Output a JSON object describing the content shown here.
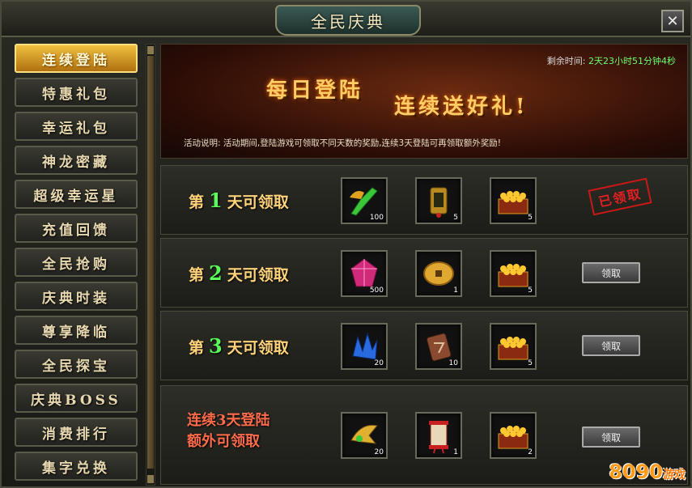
{
  "window": {
    "title": "全民庆典",
    "close": "✕"
  },
  "sidebar": {
    "items": [
      {
        "label": "连续登陆",
        "active": true
      },
      {
        "label": "特惠礼包"
      },
      {
        "label": "幸运礼包"
      },
      {
        "label": "神龙密藏"
      },
      {
        "label": "超级幸运星"
      },
      {
        "label": "充值回馈"
      },
      {
        "label": "全民抢购"
      },
      {
        "label": "庆典时装"
      },
      {
        "label": "尊享降临"
      },
      {
        "label": "全民探宝"
      },
      {
        "label": "庆典BOSS"
      },
      {
        "label": "消费排行"
      },
      {
        "label": "集字兑换"
      }
    ]
  },
  "banner": {
    "remain_label": "剩余时间:",
    "remain_value": "2天23小时51分钟4秒",
    "title1": "每日登陆",
    "title2": "连续送好礼!",
    "desc": "活动说明:  活动期间,登陆游戏可领取不同天数的奖励,连续3天登陆可再领取额外奖励!"
  },
  "rows": [
    {
      "prefix": "第",
      "day": "1",
      "suffix": "天可领取",
      "items": [
        {
          "icon": "green-weapon-icon",
          "count": "100"
        },
        {
          "icon": "token-icon",
          "count": "5"
        },
        {
          "icon": "gold-chest-icon",
          "count": "5"
        }
      ],
      "status": "已领取"
    },
    {
      "prefix": "第",
      "day": "2",
      "suffix": "天可领取",
      "items": [
        {
          "icon": "pink-gem-icon",
          "count": "500"
        },
        {
          "icon": "gold-coin-icon",
          "count": "1"
        },
        {
          "icon": "gold-chest-icon",
          "count": "5"
        }
      ],
      "button": "领取"
    },
    {
      "prefix": "第",
      "day": "3",
      "suffix": "天可领取",
      "items": [
        {
          "icon": "blue-crystal-icon",
          "count": "20"
        },
        {
          "icon": "rune-stone-icon",
          "count": "10"
        },
        {
          "icon": "gold-chest-icon",
          "count": "5"
        }
      ],
      "button": "领取"
    }
  ],
  "bonus": {
    "line1": "连续3天登陆",
    "line2": "额外可领取",
    "items": [
      {
        "icon": "gold-wing-icon",
        "count": "20"
      },
      {
        "icon": "scroll-icon",
        "count": "1"
      },
      {
        "icon": "gold-chest-icon",
        "count": "2"
      }
    ],
    "button": "领取"
  },
  "watermark": {
    "text": "8090",
    "sub": "游戏",
    "small": ".com"
  }
}
